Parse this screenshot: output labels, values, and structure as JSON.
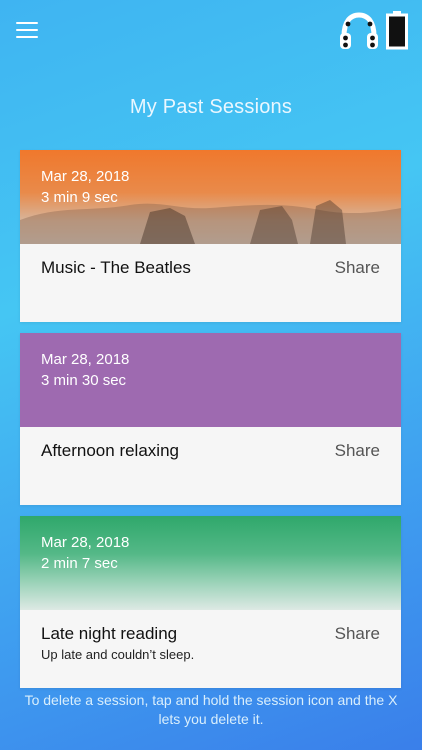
{
  "header": {
    "menu_icon": "hamburger-icon",
    "headphones_icon": "headphones-icon",
    "battery_icon": "battery-icon"
  },
  "page": {
    "title": "My Past Sessions"
  },
  "sessions": [
    {
      "date": "Mar 28, 2018",
      "duration": "3 min 9 sec",
      "name": "Music - The Beatles",
      "share_label": "Share",
      "note": "",
      "banner_color": "#f0782c"
    },
    {
      "date": "Mar 28, 2018",
      "duration": "3 min 30 sec",
      "name": "Afternoon relaxing",
      "share_label": "Share",
      "note": "",
      "banner_color": "#9e6ab0"
    },
    {
      "date": "Mar 28, 2018",
      "duration": "2 min 7 sec",
      "name": "Late night reading",
      "share_label": "Share",
      "note": "Up late and couldn’t sleep.",
      "banner_color": "#2fa86b"
    }
  ],
  "footer": {
    "hint": "To delete a session, tap and hold the session icon and the X lets you delete it."
  },
  "colors": {
    "background_top": "#3fb4f2",
    "background_bottom": "#3a7fea",
    "card_body": "#f6f6f6"
  }
}
